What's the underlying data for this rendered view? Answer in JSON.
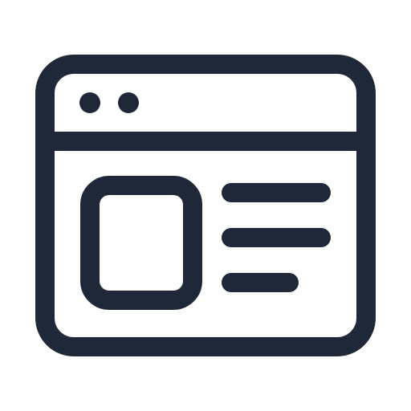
{
  "icon": {
    "name": "browser-window-content-icon",
    "stroke_color": "#1f2839",
    "background_color": "#ffffff",
    "parts": {
      "window": "browser-window-frame",
      "title_bar": "browser-title-bar",
      "dots": [
        "window-dot",
        "window-dot"
      ],
      "media_placeholder": "image-placeholder",
      "text_lines": [
        "text-line",
        "text-line",
        "text-line"
      ]
    }
  }
}
